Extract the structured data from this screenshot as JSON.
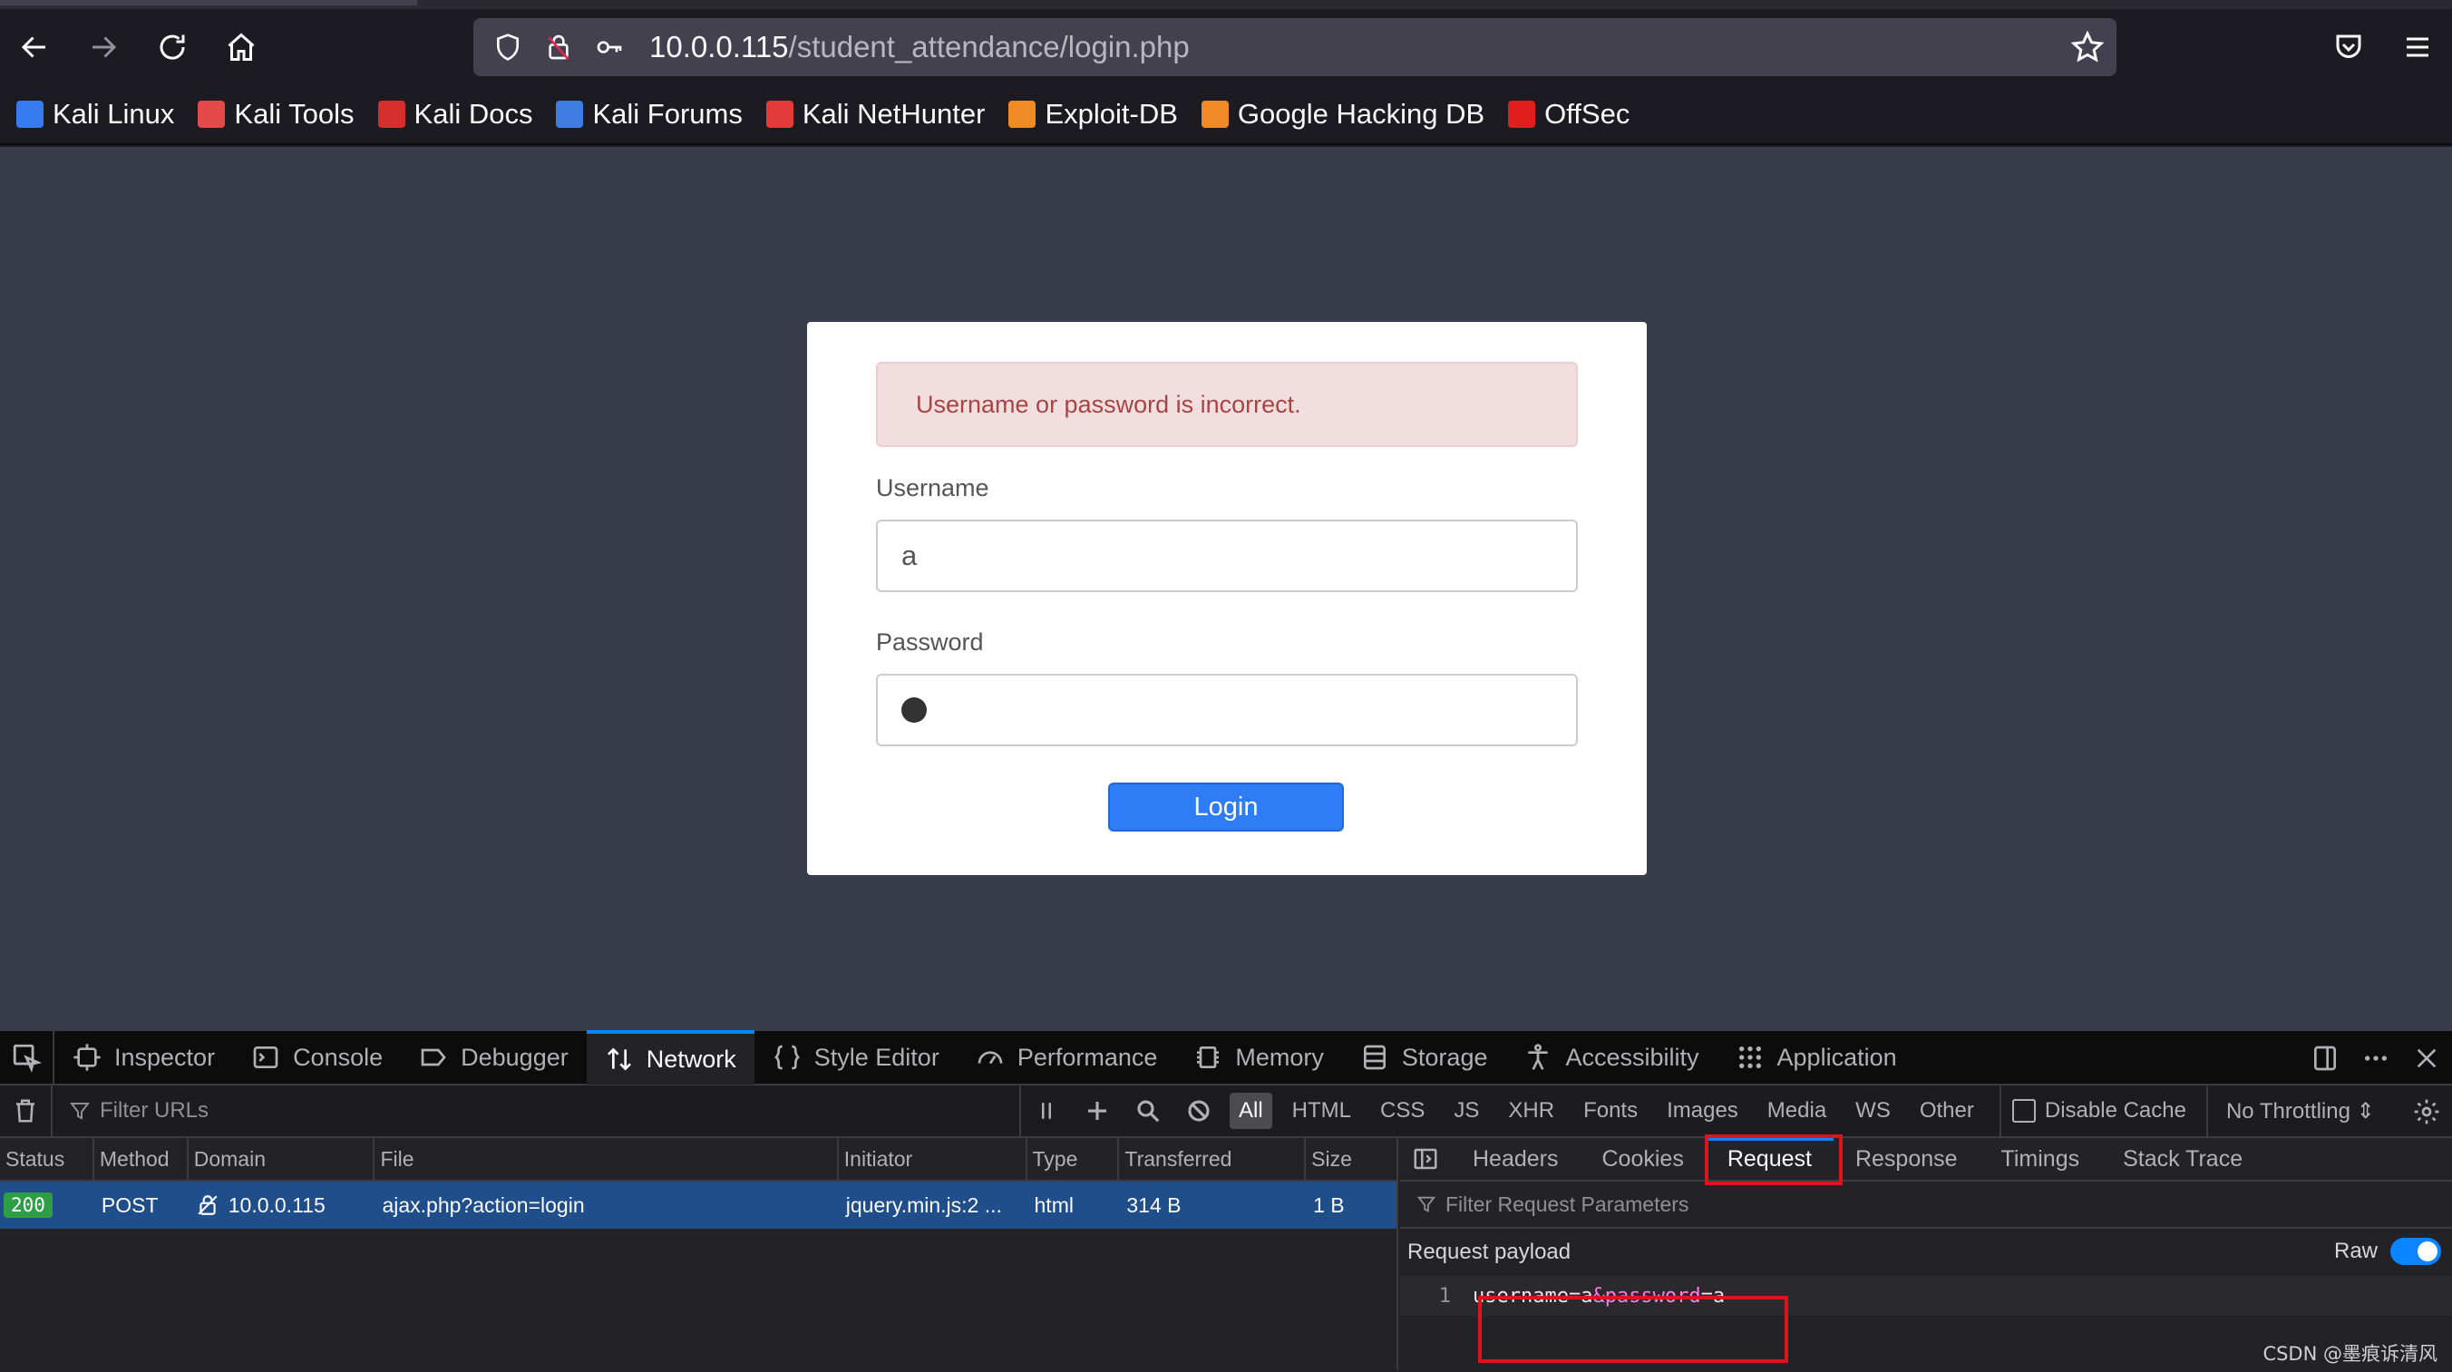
{
  "browser": {
    "url_host": "10.0.0.115",
    "url_path": "/student_attendance/login.php",
    "bookmarks": [
      {
        "label": "Kali Linux",
        "color": "#367bf0"
      },
      {
        "label": "Kali Tools",
        "color": "#e54a4a"
      },
      {
        "label": "Kali Docs",
        "color": "#d62d2d"
      },
      {
        "label": "Kali Forums",
        "color": "#3d7ce0"
      },
      {
        "label": "Kali NetHunter",
        "color": "#e23a3a"
      },
      {
        "label": "Exploit-DB",
        "color": "#f08a24"
      },
      {
        "label": "Google Hacking DB",
        "color": "#f08a24"
      },
      {
        "label": "OffSec",
        "color": "#e21d1d"
      }
    ]
  },
  "login": {
    "error": "Username or password is incorrect.",
    "username_label": "Username",
    "username_value": "a",
    "password_label": "Password",
    "button": "Login"
  },
  "devtools": {
    "tabs": [
      "Inspector",
      "Console",
      "Debugger",
      "Network",
      "Style Editor",
      "Performance",
      "Memory",
      "Storage",
      "Accessibility",
      "Application"
    ],
    "selected_tab": "Network",
    "filter_placeholder": "Filter URLs",
    "type_filters": [
      "All",
      "HTML",
      "CSS",
      "JS",
      "XHR",
      "Fonts",
      "Images",
      "Media",
      "WS",
      "Other"
    ],
    "disable_cache": "Disable Cache",
    "throttling": "No Throttling ⇕",
    "columns": [
      "Status",
      "Method",
      "Domain",
      "File",
      "Initiator",
      "Type",
      "Transferred",
      "Size"
    ],
    "request": {
      "status": "200",
      "method": "POST",
      "domain": "10.0.0.115",
      "file": "ajax.php?action=login",
      "initiator": "jquery.min.js:2 ...",
      "type": "html",
      "transferred": "314 B",
      "size": "1 B"
    },
    "panel_tabs": [
      "Headers",
      "Cookies",
      "Request",
      "Response",
      "Timings",
      "Stack Trace"
    ],
    "panel_selected": "Request",
    "filter_params_placeholder": "Filter Request Parameters",
    "payload_title": "Request payload",
    "raw_label": "Raw",
    "payload_line_number": "1",
    "payload": {
      "k1": "username=a",
      "amp": "&password",
      "k2": "=a"
    }
  },
  "watermark": "CSDN @墨痕诉清风"
}
